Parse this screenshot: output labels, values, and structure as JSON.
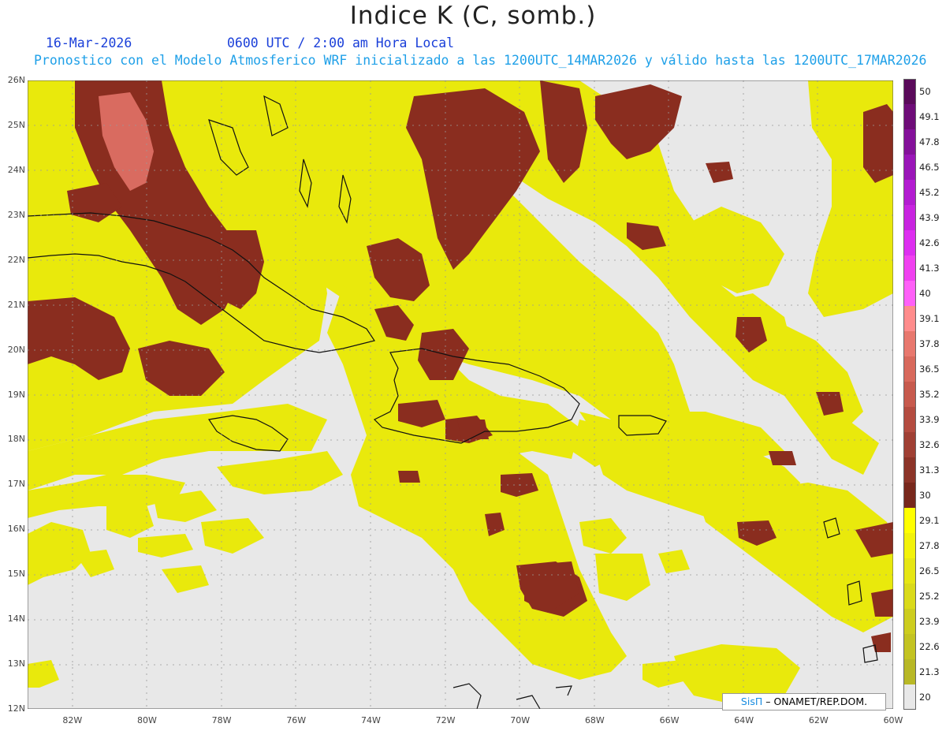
{
  "header": {
    "title": "Indice K (C, somb.)",
    "date": "16-Mar-2026",
    "time": "0600 UTC / 2:00 am Hora Local",
    "description": "Pronostico con el Modelo Atmosferico WRF inicializado a las 1200UTC_14MAR2026 y válido hasta las  1200UTC_17MAR2026"
  },
  "axes": {
    "lat_labels": [
      "26N",
      "25N",
      "24N",
      "23N",
      "22N",
      "21N",
      "20N",
      "19N",
      "18N",
      "17N",
      "16N",
      "15N",
      "14N",
      "13N",
      "12N"
    ],
    "lon_labels": [
      "82W",
      "80W",
      "78W",
      "76W",
      "74W",
      "72W",
      "70W",
      "68W",
      "66W",
      "64W",
      "62W",
      "60W"
    ],
    "lat_range": [
      12,
      26
    ],
    "lon_range": [
      -83.2,
      -60
    ]
  },
  "colorbar": {
    "levels": [
      "50",
      "49.1",
      "47.8",
      "46.5",
      "45.2",
      "43.9",
      "42.6",
      "41.3",
      "40",
      "39.1",
      "37.8",
      "36.5",
      "35.2",
      "33.9",
      "32.6",
      "31.3",
      "30",
      "29.1",
      "27.8",
      "26.5",
      "25.2",
      "23.9",
      "22.6",
      "21.3",
      "20"
    ],
    "colors": [
      "#5a0a5a",
      "#6e0c78",
      "#84119a",
      "#9a16b8",
      "#b31cd1",
      "#c823e0",
      "#dd2ef0",
      "#f040f0",
      "#ff60f8",
      "#ff8c8c",
      "#e8786e",
      "#d8695c",
      "#c75a4d",
      "#b44c40",
      "#a04034",
      "#8c3428",
      "#78281c",
      "#ffff00",
      "#f2f20a",
      "#e6e613",
      "#dada1a",
      "#cdcd1f",
      "#c3c322",
      "#b8b826",
      "#e8e8e8"
    ]
  },
  "credit": {
    "logo_text": "SisΠ",
    "org_text": "– ONAMET/REP.DOM."
  }
}
